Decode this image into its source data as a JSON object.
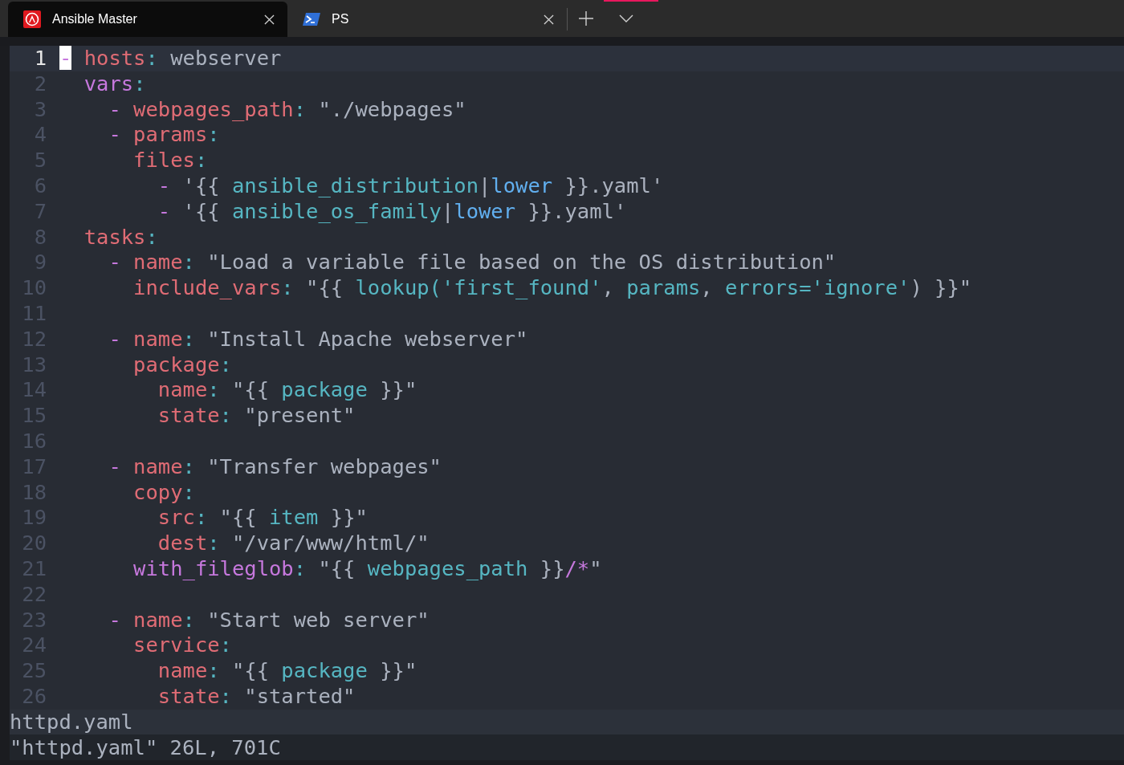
{
  "tabs": [
    {
      "title": "Ansible Master",
      "kind": "app",
      "selected": true
    },
    {
      "title": "PS",
      "kind": "terminal",
      "selected": false
    }
  ],
  "editor": {
    "lines": [
      {
        "number": "1",
        "current": true,
        "tokens": [
          {
            "kind": "cursor",
            "text": "-"
          },
          {
            "kind": "key",
            "text": " hosts"
          },
          {
            "kind": "colon",
            "text": ":"
          },
          {
            "kind": "plain",
            "text": " webserver"
          }
        ]
      },
      {
        "number": "2",
        "current": false,
        "tokens": [
          {
            "kind": "keyp",
            "text": "  vars"
          },
          {
            "kind": "colon",
            "text": ":"
          }
        ]
      },
      {
        "number": "3",
        "current": false,
        "tokens": [
          {
            "kind": "dash",
            "text": "    -"
          },
          {
            "kind": "key",
            "text": " webpages_path"
          },
          {
            "kind": "colon",
            "text": ":"
          },
          {
            "kind": "plain",
            "text": " \"./webpages\""
          }
        ]
      },
      {
        "number": "4",
        "current": false,
        "tokens": [
          {
            "kind": "dash",
            "text": "    -"
          },
          {
            "kind": "key",
            "text": " params"
          },
          {
            "kind": "colon",
            "text": ":"
          }
        ]
      },
      {
        "number": "5",
        "current": false,
        "tokens": [
          {
            "kind": "key",
            "text": "      files"
          },
          {
            "kind": "colon",
            "text": ":"
          }
        ]
      },
      {
        "number": "6",
        "current": false,
        "tokens": [
          {
            "kind": "dash",
            "text": "        -"
          },
          {
            "kind": "plain",
            "text": " '{{ "
          },
          {
            "kind": "var",
            "text": "ansible_distribution"
          },
          {
            "kind": "plain",
            "text": "|"
          },
          {
            "kind": "filter",
            "text": "lower"
          },
          {
            "kind": "plain",
            "text": " }}.yaml'"
          }
        ]
      },
      {
        "number": "7",
        "current": false,
        "tokens": [
          {
            "kind": "dash",
            "text": "        -"
          },
          {
            "kind": "plain",
            "text": " '{{ "
          },
          {
            "kind": "var",
            "text": "ansible_os_family"
          },
          {
            "kind": "plain",
            "text": "|"
          },
          {
            "kind": "filter",
            "text": "lower"
          },
          {
            "kind": "plain",
            "text": " }}.yaml'"
          }
        ]
      },
      {
        "number": "8",
        "current": false,
        "tokens": [
          {
            "kind": "key",
            "text": "  tasks"
          },
          {
            "kind": "colon",
            "text": ":"
          }
        ]
      },
      {
        "number": "9",
        "current": false,
        "tokens": [
          {
            "kind": "dash",
            "text": "    -"
          },
          {
            "kind": "key",
            "text": " name"
          },
          {
            "kind": "colon",
            "text": ":"
          },
          {
            "kind": "plain",
            "text": " \"Load a variable file based on the OS distribution\""
          }
        ]
      },
      {
        "number": "10",
        "current": false,
        "tokens": [
          {
            "kind": "key",
            "text": "      include_vars"
          },
          {
            "kind": "colon",
            "text": ":"
          },
          {
            "kind": "plain",
            "text": " \"{{ "
          },
          {
            "kind": "var",
            "text": "lookup('first_found'"
          },
          {
            "kind": "plain",
            "text": ", "
          },
          {
            "kind": "var",
            "text": "params"
          },
          {
            "kind": "plain",
            "text": ", "
          },
          {
            "kind": "var",
            "text": "errors='ignore'"
          },
          {
            "kind": "plain",
            "text": ") }}\""
          }
        ]
      },
      {
        "number": "11",
        "current": false
      },
      {
        "number": "12",
        "current": false,
        "tokens": [
          {
            "kind": "dash",
            "text": "    -"
          },
          {
            "kind": "key",
            "text": " name"
          },
          {
            "kind": "colon",
            "text": ":"
          },
          {
            "kind": "plain",
            "text": " \"Install Apache webserver\""
          }
        ]
      },
      {
        "number": "13",
        "current": false,
        "tokens": [
          {
            "kind": "key",
            "text": "      package"
          },
          {
            "kind": "colon",
            "text": ":"
          }
        ]
      },
      {
        "number": "14",
        "current": false,
        "tokens": [
          {
            "kind": "key",
            "text": "        name"
          },
          {
            "kind": "colon",
            "text": ":"
          },
          {
            "kind": "plain",
            "text": " \"{{ "
          },
          {
            "kind": "var",
            "text": "package"
          },
          {
            "kind": "plain",
            "text": " }}\""
          }
        ]
      },
      {
        "number": "15",
        "current": false,
        "tokens": [
          {
            "kind": "key",
            "text": "        state"
          },
          {
            "kind": "colon",
            "text": ":"
          },
          {
            "kind": "plain",
            "text": " \"present\""
          }
        ]
      },
      {
        "number": "16",
        "current": false
      },
      {
        "number": "17",
        "current": false,
        "tokens": [
          {
            "kind": "dash",
            "text": "    -"
          },
          {
            "kind": "key",
            "text": " name"
          },
          {
            "kind": "colon",
            "text": ":"
          },
          {
            "kind": "plain",
            "text": " \"Transfer webpages\""
          }
        ]
      },
      {
        "number": "18",
        "current": false,
        "tokens": [
          {
            "kind": "key",
            "text": "      copy"
          },
          {
            "kind": "colon",
            "text": ":"
          }
        ]
      },
      {
        "number": "19",
        "current": false,
        "tokens": [
          {
            "kind": "key",
            "text": "        src"
          },
          {
            "kind": "colon",
            "text": ":"
          },
          {
            "kind": "plain",
            "text": " \"{{ "
          },
          {
            "kind": "var",
            "text": "item"
          },
          {
            "kind": "plain",
            "text": " }}\""
          }
        ]
      },
      {
        "number": "20",
        "current": false,
        "tokens": [
          {
            "kind": "key",
            "text": "        dest"
          },
          {
            "kind": "colon",
            "text": ":"
          },
          {
            "kind": "plain",
            "text": " \"/var/www/html/\""
          }
        ]
      },
      {
        "number": "21",
        "current": false,
        "tokens": [
          {
            "kind": "keyp",
            "text": "      with_fileglob"
          },
          {
            "kind": "colon",
            "text": ":"
          },
          {
            "kind": "plain",
            "text": " \"{{ "
          },
          {
            "kind": "var",
            "text": "webpages_path"
          },
          {
            "kind": "plain",
            "text": " }}"
          },
          {
            "kind": "keyp",
            "text": "/*"
          },
          {
            "kind": "plain",
            "text": "\""
          }
        ]
      },
      {
        "number": "22",
        "current": false
      },
      {
        "number": "23",
        "current": false,
        "tokens": [
          {
            "kind": "dash",
            "text": "    -"
          },
          {
            "kind": "key",
            "text": " name"
          },
          {
            "kind": "colon",
            "text": ":"
          },
          {
            "kind": "plain",
            "text": " \"Start web server\""
          }
        ]
      },
      {
        "number": "24",
        "current": false,
        "tokens": [
          {
            "kind": "key",
            "text": "      service"
          },
          {
            "kind": "colon",
            "text": ":"
          }
        ]
      },
      {
        "number": "25",
        "current": false,
        "tokens": [
          {
            "kind": "key",
            "text": "        name"
          },
          {
            "kind": "colon",
            "text": ":"
          },
          {
            "kind": "plain",
            "text": " \"{{ "
          },
          {
            "kind": "var",
            "text": "package"
          },
          {
            "kind": "plain",
            "text": " }}\""
          }
        ]
      },
      {
        "number": "26",
        "current": false,
        "tokens": [
          {
            "kind": "key",
            "text": "        state"
          },
          {
            "kind": "colon",
            "text": ":"
          },
          {
            "kind": "plain",
            "text": " \"started\""
          }
        ]
      }
    ]
  },
  "status_line": "httpd.yaml",
  "message_line": "\"httpd.yaml\" 26L, 701C"
}
